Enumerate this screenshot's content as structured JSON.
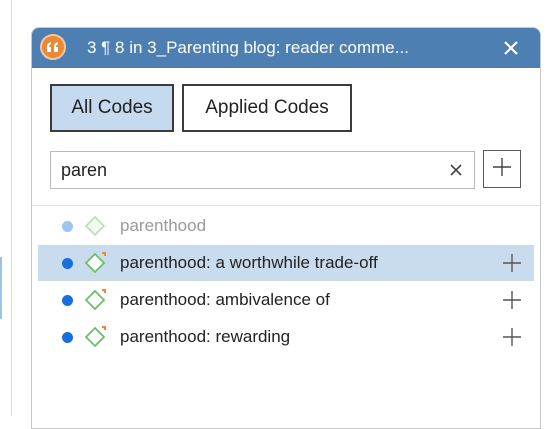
{
  "window": {
    "title": "3 ¶ 8 in 3_Parenting blog: reader comme...",
    "quote_icon": "quotation-icon",
    "close_icon": "close-icon",
    "accent_color": "#4e7fb3",
    "quote_color": "#e9893a"
  },
  "filter_tabs": {
    "all_codes": "All Codes",
    "applied_codes": "Applied Codes",
    "active": "All Codes"
  },
  "search": {
    "value": "paren",
    "clear_icon": "clear-icon",
    "add_icon": "plus-icon"
  },
  "codes": [
    {
      "label": "parenthood",
      "faded": true,
      "selected": false,
      "has_add": false
    },
    {
      "label": "parenthood: a worthwhile trade-off",
      "faded": false,
      "selected": true,
      "has_add": true
    },
    {
      "label": "parenthood: ambivalence of",
      "faded": false,
      "selected": false,
      "has_add": true
    },
    {
      "label": "parenthood: rewarding",
      "faded": false,
      "selected": false,
      "has_add": true
    }
  ],
  "colors": {
    "selected_row": "#c9dcee",
    "code_dot": "#1a6fe0",
    "code_diamond": "#6bbf6b",
    "code_marker": "#e9893a"
  }
}
